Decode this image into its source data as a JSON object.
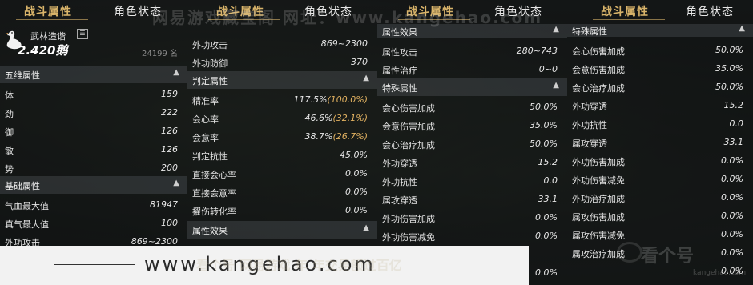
{
  "tabs": {
    "battle": "战斗属性",
    "role": "角色状态"
  },
  "watermark_top": "网易游戏藏宝阁  网址：www.kangehao.com",
  "profile": {
    "guild": "武林造谐",
    "score": "2.420鹅",
    "rank": "24199 名"
  },
  "panel1": {
    "sec_five": "五维属性",
    "five": [
      {
        "label": "体",
        "value": "159"
      },
      {
        "label": "劲",
        "value": "222"
      },
      {
        "label": "御",
        "value": "126"
      },
      {
        "label": "敏",
        "value": "126"
      },
      {
        "label": "势",
        "value": "200"
      }
    ],
    "sec_base": "基础属性",
    "base": [
      {
        "label": "气血最大值",
        "value": "81947"
      },
      {
        "label": "真气最大值",
        "value": "100"
      },
      {
        "label": "外功攻击",
        "value": "869~2300"
      }
    ]
  },
  "panel2": {
    "top": [
      {
        "label": "外功攻击",
        "value": "869~2300"
      },
      {
        "label": "外功防御",
        "value": "370"
      }
    ],
    "sec_judge": "判定属性",
    "judge": [
      {
        "label": "精准率",
        "value": "117.5%",
        "pct": "(100.0%)"
      },
      {
        "label": "会心率",
        "value": "46.6%",
        "pct": "(32.1%)"
      },
      {
        "label": "会意率",
        "value": "38.7%",
        "pct": "(26.7%)"
      },
      {
        "label": "判定抗性",
        "value": "45.0%",
        "pct": ""
      },
      {
        "label": "直接会心率",
        "value": "0.0%",
        "pct": ""
      },
      {
        "label": "直接会意率",
        "value": "0.0%",
        "pct": ""
      },
      {
        "label": "擢伤转化率",
        "value": "0.0%",
        "pct": ""
      }
    ],
    "sec_attr": "属性效果"
  },
  "panel3": {
    "sec_attr": "属性效果",
    "attr": [
      {
        "label": "属性攻击",
        "value": "280~743"
      },
      {
        "label": "属性治疗",
        "value": "0~0"
      }
    ],
    "sec_special": "特殊属性",
    "special": [
      {
        "label": "会心伤害加成",
        "value": "50.0%"
      },
      {
        "label": "会意伤害加成",
        "value": "35.0%"
      },
      {
        "label": "会心治疗加成",
        "value": "50.0%"
      },
      {
        "label": "外功穿透",
        "value": "15.2"
      },
      {
        "label": "外功抗性",
        "value": "0.0"
      },
      {
        "label": "属攻穿透",
        "value": "33.1"
      },
      {
        "label": "外功伤害加成",
        "value": "0.0%"
      },
      {
        "label": "外功伤害减免",
        "value": "0.0%"
      },
      {
        "label": "",
        "value": "0.0%"
      }
    ]
  },
  "panel4": {
    "sec_special": "特殊属性",
    "special": [
      {
        "label": "会心伤害加成",
        "value": "50.0%"
      },
      {
        "label": "会意伤害加成",
        "value": "35.0%"
      },
      {
        "label": "会心治疗加成",
        "value": "50.0%"
      },
      {
        "label": "外功穿透",
        "value": "15.2"
      },
      {
        "label": "外功抗性",
        "value": "0.0"
      },
      {
        "label": "属攻穿透",
        "value": "33.1"
      },
      {
        "label": "外功伤害加成",
        "value": "0.0%"
      },
      {
        "label": "外功伤害减免",
        "value": "0.0%"
      },
      {
        "label": "外功治疗加成",
        "value": "0.0%"
      },
      {
        "label": "属攻伤害加成",
        "value": "0.0%"
      },
      {
        "label": "属攻伤害减免",
        "value": "0.0%"
      },
      {
        "label": "属攻治疗加成",
        "value": "0.0%"
      },
      {
        "label": "",
        "value": "0.0%"
      }
    ]
  },
  "banner": {
    "text": "www.kangehao.com"
  },
  "watermark_bottom": "看个号 网易游戏 年 年交易额过百亿",
  "brand": {
    "name": "看个号",
    "url": "kangehao.com"
  }
}
